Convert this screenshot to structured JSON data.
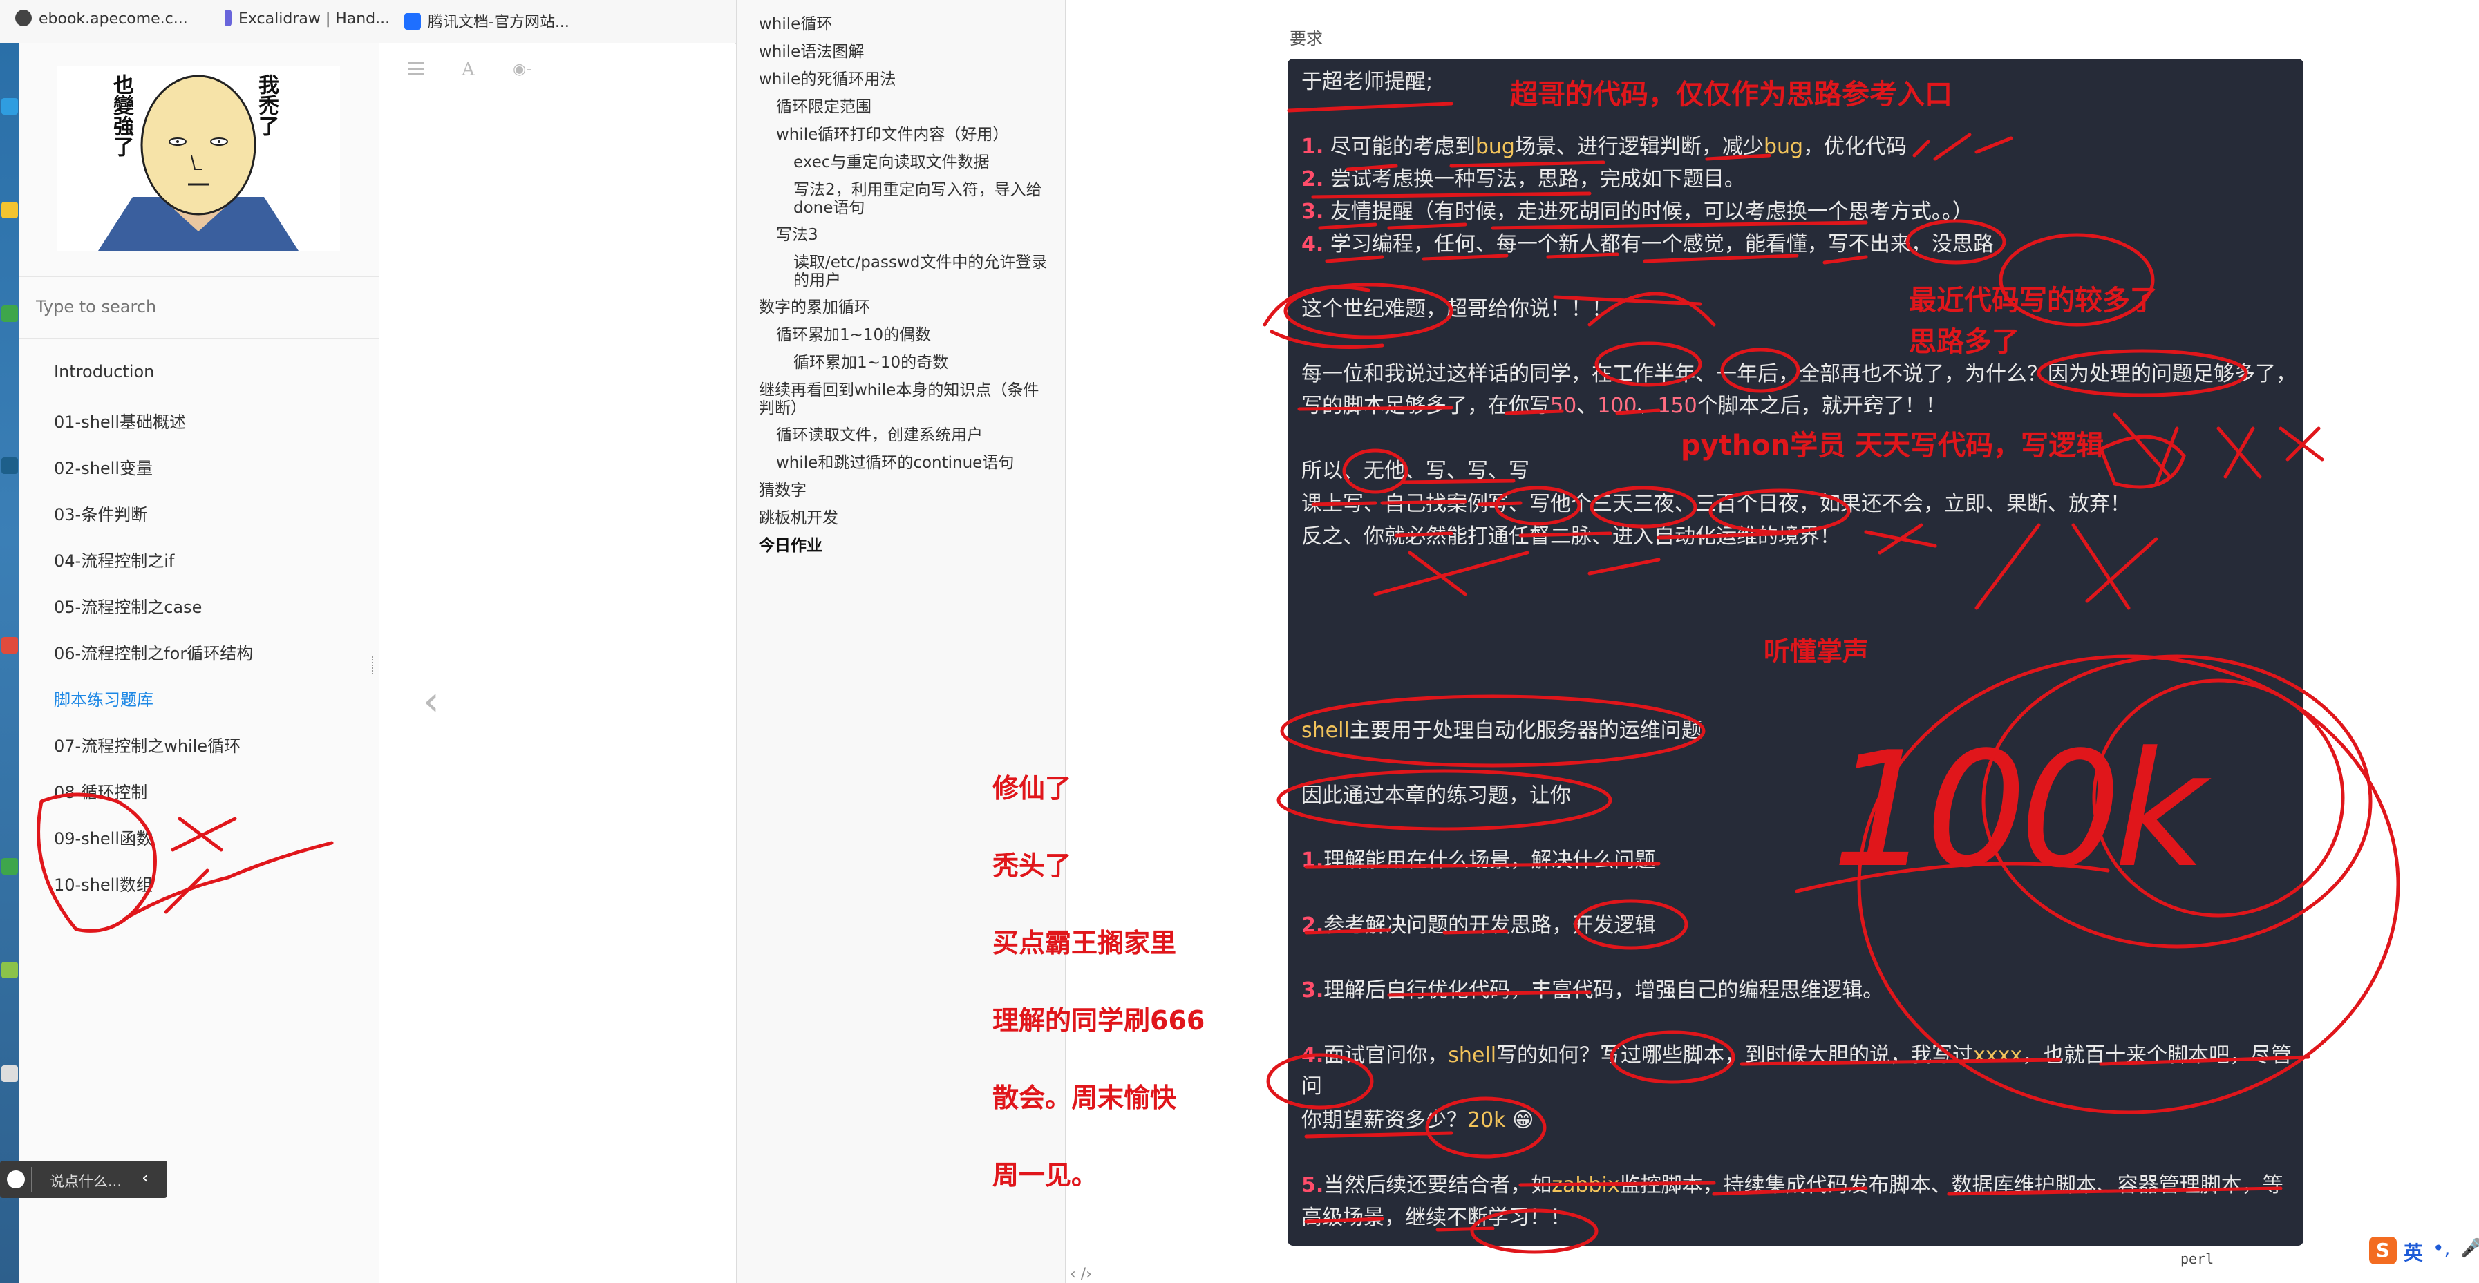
{
  "bookmarks": [
    {
      "label": "ebook.apecome.c...",
      "color": "#333333"
    },
    {
      "label": "Excalidraw | Hand...",
      "color": "#6965db"
    },
    {
      "label": "腾讯文档-官方网站...",
      "color": "#1e6fff"
    }
  ],
  "sidebar": {
    "meme": {
      "left_text": "也變強了",
      "right_text": "我禿了"
    },
    "search_placeholder": "Type to search",
    "items": [
      {
        "label": "Introduction"
      },
      {
        "label": "01-shell基础概述"
      },
      {
        "label": "02-shell变量"
      },
      {
        "label": "03-条件判断"
      },
      {
        "label": "04-流程控制之if"
      },
      {
        "label": "05-流程控制之case"
      },
      {
        "label": "06-流程控制之for循环结构"
      },
      {
        "label": "脚本练习题库",
        "active": true
      },
      {
        "label": "07-流程控制之while循环"
      },
      {
        "label": "08-循环控制"
      },
      {
        "label": "09-shell函数"
      },
      {
        "label": "10-shell数组"
      }
    ]
  },
  "chat": {
    "placeholder": "说点什么..."
  },
  "reading_toolbar": {
    "icons": [
      "list-icon",
      "font-icon",
      "eye-icon"
    ]
  },
  "right_toc": [
    {
      "label": "while循环",
      "level": 1
    },
    {
      "label": "while语法图解",
      "level": 1
    },
    {
      "label": "while的死循环用法",
      "level": 1
    },
    {
      "label": "循环限定范围",
      "level": 2
    },
    {
      "label": "while循环打印文件内容（好用）",
      "level": 2
    },
    {
      "label": "exec与重定向读取文件数据",
      "level": 3
    },
    {
      "label": "写法2，利用重定向写入符，导入给done语句",
      "level": 3
    },
    {
      "label": "写法3",
      "level": 2
    },
    {
      "label": "读取/etc/passwd文件中的允许登录的用户",
      "level": 3
    },
    {
      "label": "数字的累加循环",
      "level": 1
    },
    {
      "label": "循环累加1~10的偶数",
      "level": 2
    },
    {
      "label": "循环累加1~10的奇数",
      "level": 3
    },
    {
      "label": "继续再看回到while本身的知识点（条件判断）",
      "level": 1
    },
    {
      "label": "循环读取文件，创建系统用户",
      "level": 2
    },
    {
      "label": "while和跳过循环的continue语句",
      "level": 2
    },
    {
      "label": "猜数字",
      "level": 1
    },
    {
      "label": "跳板机开发",
      "level": 1
    },
    {
      "label": "今日作业",
      "level": 1,
      "bold": true
    }
  ],
  "content": {
    "heading": "要求",
    "line_intro": "于超老师提醒;",
    "items": [
      {
        "num": "1.",
        "a": "尽可能的考虑到",
        "k1": "bug",
        "b": "场景、进行逻辑判断，减少",
        "k2": "bug",
        "c": "，优化代码"
      },
      {
        "num": "2.",
        "text": "尝试考虑换一种写法，思路，完成如下题目。"
      },
      {
        "num": "3.",
        "text": "友情提醒（有时候，走进死胡同的时候，可以考虑换一个思考方式。。）"
      },
      {
        "num": "4.",
        "text": "学习编程，任何、每一个新人都有一个感觉，能看懂，写不出来，没思路"
      }
    ],
    "century": "这个世纪难题，超哥给你说！！！",
    "para1_a": "每一位和我说过这样话的同学，在工作半年、一年后，全部再也不说了，为什么？因为处理的问题足够多了，",
    "para1_b1": "写的脚本足够多了，在你写",
    "n50": "50",
    "sep1": "、",
    "n100": "100",
    "sep2": "、",
    "n150": "150",
    "para1_b2": "个脚本之后，就开窍了！！",
    "soyi": "所以、无他、写、写、写",
    "keshang": "课上写、自己找案例写、写他个三天三夜、三百个日夜，如果还不会，立即、果断、放弃！",
    "fanzhi": "反之、你就必然能打通任督二脉、进入自动化运维的境界！",
    "shell_kw": "shell",
    "shell_rest": "主要用于处理自动化服务器的运维问题",
    "yinci": "因此通过本章的练习题，让你",
    "g1_num": "1.",
    "g1": "理解能用在什么场景，解决什么问题",
    "g2_num": "2.",
    "g2": "参考解决问题的开发思路，开发逻辑",
    "g3_num": "3.",
    "g3": "理解后自行优化代码，丰富代码，增强自己的编程思维逻辑。",
    "g4_num": "4.",
    "g4_a": "面试官问你，",
    "g4_kw": "shell",
    "g4_b": "写的如何？写过哪些脚本，到时候大胆的说，我写过",
    "g4_x": "xxxx",
    "g4_c": "，也就百十来个脚本吧，尽管",
    "g4_d": "问",
    "salary_a": "你期望薪资多少？",
    "salary_kw": "20k",
    "salary_emoji": "😁",
    "g5_num": "5.",
    "g5_a": "当然后续还要结合者，如",
    "g5_kw": "zabbix",
    "g5_b": "监控脚本，持续集成代码发布脚本、数据库维护脚本、容器管理脚本，等",
    "g5_c": "高级场景，继续不断学习！！"
  },
  "annotations": {
    "title": "超哥的代码，仅仅作为思路参考入口",
    "recent1": "最近代码写的较多了",
    "recent2": "思路多了",
    "python": "python学员 天天写代码，写逻辑",
    "tingdong": "听懂掌声",
    "left_notes": [
      "修仙了",
      "秃头了",
      "买点霸王搁家里",
      "理解的同学刷666",
      "散会。周末愉快",
      "周一见。"
    ],
    "big": "100k"
  },
  "footer": {
    "code_lang": "perl",
    "ime": "英"
  }
}
